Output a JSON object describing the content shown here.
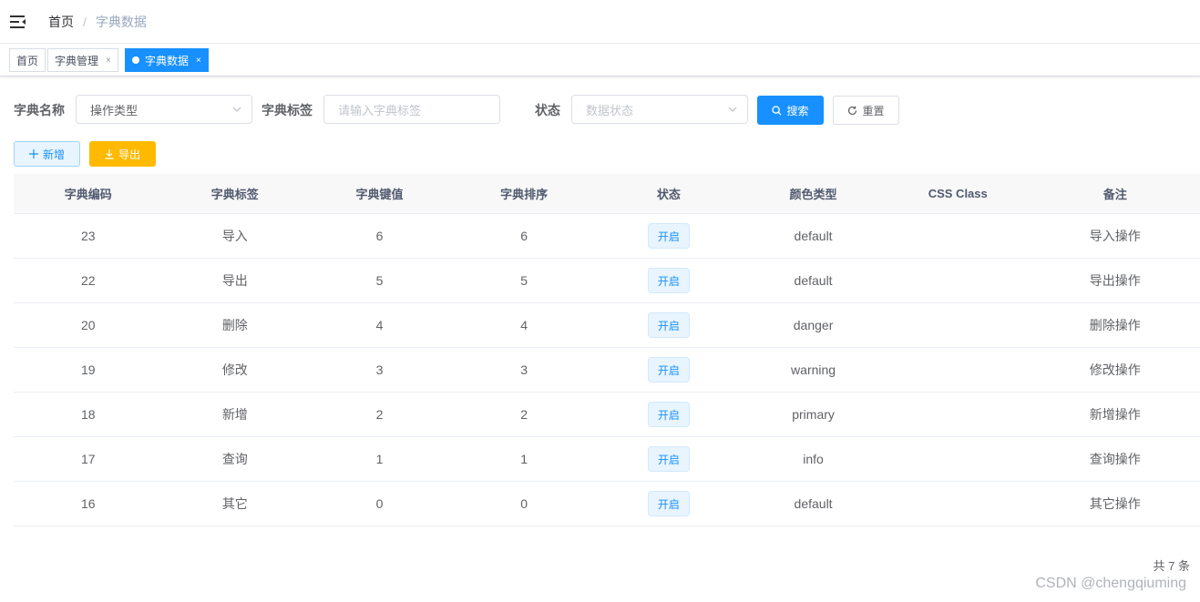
{
  "breadcrumb": {
    "home": "首页",
    "separator": "/",
    "current": "字典数据"
  },
  "tags": [
    {
      "label": "首页"
    },
    {
      "label": "字典管理",
      "close": "×"
    },
    {
      "label": "字典数据",
      "close": "×",
      "active": true
    }
  ],
  "search": {
    "dict_name_label": "字典名称",
    "dict_name_value": "操作类型",
    "dict_label_label": "字典标签",
    "dict_label_placeholder": "请输入字典标签",
    "status_label": "状态",
    "status_placeholder": "数据状态",
    "search_button": "搜索",
    "reset_button": "重置"
  },
  "toolbar": {
    "add_button": "新增",
    "export_button": "导出"
  },
  "table": {
    "columns": [
      "字典编码",
      "字典标签",
      "字典键值",
      "字典排序",
      "状态",
      "颜色类型",
      "CSS Class",
      "备注"
    ],
    "rows": [
      {
        "code": "23",
        "label": "导入",
        "value": "6",
        "sort": "6",
        "status": "开启",
        "color": "default",
        "css": "",
        "remark": "导入操作"
      },
      {
        "code": "22",
        "label": "导出",
        "value": "5",
        "sort": "5",
        "status": "开启",
        "color": "default",
        "css": "",
        "remark": "导出操作"
      },
      {
        "code": "20",
        "label": "删除",
        "value": "4",
        "sort": "4",
        "status": "开启",
        "color": "danger",
        "css": "",
        "remark": "删除操作"
      },
      {
        "code": "19",
        "label": "修改",
        "value": "3",
        "sort": "3",
        "status": "开启",
        "color": "warning",
        "css": "",
        "remark": "修改操作"
      },
      {
        "code": "18",
        "label": "新增",
        "value": "2",
        "sort": "2",
        "status": "开启",
        "color": "primary",
        "css": "",
        "remark": "新增操作"
      },
      {
        "code": "17",
        "label": "查询",
        "value": "1",
        "sort": "1",
        "status": "开启",
        "color": "info",
        "css": "",
        "remark": "查询操作"
      },
      {
        "code": "16",
        "label": "其它",
        "value": "0",
        "sort": "0",
        "status": "开启",
        "color": "default",
        "css": "",
        "remark": "其它操作"
      }
    ]
  },
  "pagination": {
    "total": "共 7 条"
  },
  "watermark": "CSDN @chengqiuming",
  "colors": {
    "primary": "#1890ff",
    "warning": "#ffba00",
    "header_bg": "#f8f8f9"
  }
}
